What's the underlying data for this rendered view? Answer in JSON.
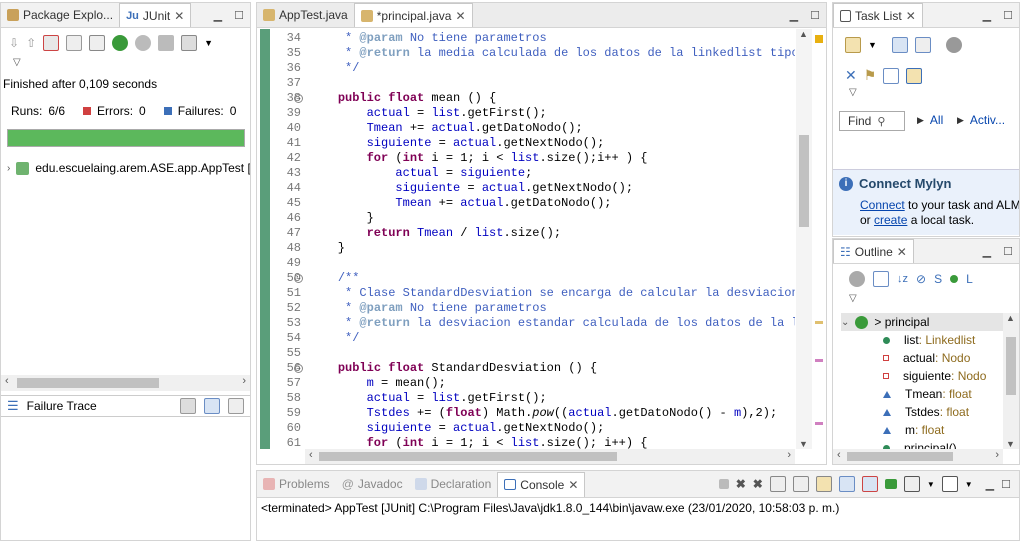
{
  "left_pane": {
    "tabs": [
      {
        "label": "Package Explo..."
      },
      {
        "label": "JUnit"
      }
    ],
    "status": "Finished after 0,109 seconds",
    "runs_label": "Runs:",
    "runs_value": "6/6",
    "errors_label": "Errors:",
    "errors_value": "0",
    "failures_label": "Failures:",
    "failures_value": "0",
    "progress": 1.0,
    "progress_color": "#5cb85c",
    "tree_item": "edu.escuelaing.arem.ASE.app.AppTest [",
    "failure_trace": "Failure Trace"
  },
  "editor": {
    "tabs": [
      {
        "label": "AppTest.java"
      },
      {
        "label": "*principal.java"
      }
    ],
    "lines": [
      {
        "n": "34",
        "fold": false,
        "html": "     <span class='cmt'>* <span class='tag'>@param</span> No tiene parametros</span>"
      },
      {
        "n": "35",
        "fold": false,
        "html": "     <span class='cmt'>* <span class='tag'>@return</span> la media calculada de los datos de la linkedlist tipo f</span>"
      },
      {
        "n": "36",
        "fold": false,
        "html": "     <span class='cmt'>*/</span>"
      },
      {
        "n": "37",
        "fold": false,
        "html": ""
      },
      {
        "n": "38",
        "fold": true,
        "html": "    <span class='kw'>public float</span> mean () {"
      },
      {
        "n": "39",
        "fold": false,
        "html": "        <span class='fld'>actual</span> = <span class='fld'>list</span>.getFirst();"
      },
      {
        "n": "40",
        "fold": false,
        "html": "        <span class='fld'>Tmean</span> += <span class='fld'>actual</span>.getDatoNodo();"
      },
      {
        "n": "41",
        "fold": false,
        "html": "        <span class='fld'>siguiente</span> = <span class='fld'>actual</span>.getNextNodo();"
      },
      {
        "n": "42",
        "fold": false,
        "html": "        <span class='kw'>for</span> (<span class='kw'>int</span> i = 1; i &lt; <span class='fld'>list</span>.size();i++ ) {"
      },
      {
        "n": "43",
        "fold": false,
        "html": "            <span class='fld'>actual</span> = <span class='fld'>siguiente</span>;"
      },
      {
        "n": "44",
        "fold": false,
        "html": "            <span class='fld'>siguiente</span> = <span class='fld'>actual</span>.getNextNodo();"
      },
      {
        "n": "45",
        "fold": false,
        "html": "            <span class='fld'>Tmean</span> += <span class='fld'>actual</span>.getDatoNodo();"
      },
      {
        "n": "46",
        "fold": false,
        "html": "        }"
      },
      {
        "n": "47",
        "fold": false,
        "html": "        <span class='kw'>return</span> <span class='fld'>Tmean</span> / <span class='fld'>list</span>.size();"
      },
      {
        "n": "48",
        "fold": false,
        "html": "    }"
      },
      {
        "n": "49",
        "fold": false,
        "html": ""
      },
      {
        "n": "50",
        "fold": true,
        "html": "    <span class='cmt'>/**</span>"
      },
      {
        "n": "51",
        "fold": false,
        "html": "     <span class='cmt'>* Clase StandardDesviation se encarga de calcular la desviacion e</span>"
      },
      {
        "n": "52",
        "fold": false,
        "html": "     <span class='cmt'>* <span class='tag'>@param</span> No tiene parametros</span>"
      },
      {
        "n": "53",
        "fold": false,
        "html": "     <span class='cmt'>* <span class='tag'>@return</span> la desviacion estandar calculada de los datos de la lin</span>"
      },
      {
        "n": "54",
        "fold": false,
        "html": "     <span class='cmt'>*/</span>"
      },
      {
        "n": "55",
        "fold": false,
        "html": ""
      },
      {
        "n": "56",
        "fold": true,
        "html": "    <span class='kw'>public float</span> StandardDesviation () {"
      },
      {
        "n": "57",
        "fold": false,
        "html": "        <span class='fld'>m</span> = mean();"
      },
      {
        "n": "58",
        "fold": false,
        "html": "        <span class='fld'>actual</span> = <span class='fld'>list</span>.getFirst();"
      },
      {
        "n": "59",
        "fold": false,
        "html": "        <span class='fld'>Tstdes</span> += (<span class='kw'>float</span>) Math.<i>pow</i>((<span class='fld'>actual</span>.getDatoNodo() - <span class='fld'>m</span>),2);"
      },
      {
        "n": "60",
        "fold": false,
        "html": "        <span class='fld'>siguiente</span> = <span class='fld'>actual</span>.getNextNodo();"
      },
      {
        "n": "61",
        "fold": false,
        "html": "        <span class='kw'>for</span> (<span class='kw'>int</span> i = 1; i &lt; <span class='fld'>list</span>.size(); i++) {"
      }
    ]
  },
  "task_list": {
    "tab": "Task List",
    "find_placeholder": "Find",
    "all": "All",
    "activate": "Activ...",
    "mylyn_title": "Connect Mylyn",
    "mylyn_link1": "Connect",
    "mylyn_text1": " to your task and ALM",
    "mylyn_text2": "or ",
    "mylyn_link2": "create",
    "mylyn_text3": " a local task."
  },
  "outline": {
    "tab": "Outline",
    "root": "> principal",
    "items": [
      {
        "name": "list",
        "type": " : Linkedlist",
        "color": "#2e8b57",
        "shape": "circle"
      },
      {
        "name": "actual",
        "type": " : Nodo",
        "color": "#d04040",
        "shape": "square"
      },
      {
        "name": "siguiente",
        "type": " : Nodo",
        "color": "#d04040",
        "shape": "square"
      },
      {
        "name": "Tmean",
        "type": " : float",
        "color": "#3c6fb8",
        "shape": "triangle"
      },
      {
        "name": "Tstdes",
        "type": " : float",
        "color": "#3c6fb8",
        "shape": "triangle"
      },
      {
        "name": "m",
        "type": " : float",
        "color": "#3c6fb8",
        "shape": "triangle"
      },
      {
        "name": "principal()",
        "type": "",
        "color": "#2e8b57",
        "shape": "circle"
      }
    ]
  },
  "console": {
    "tabs": [
      {
        "label": "Problems"
      },
      {
        "label": "Javadoc"
      },
      {
        "label": "Declaration"
      },
      {
        "label": "Console"
      }
    ],
    "output": "<terminated> AppTest [JUnit] C:\\Program Files\\Java\\jdk1.8.0_144\\bin\\javaw.exe (23/01/2020, 10:58:03 p. m.)"
  }
}
